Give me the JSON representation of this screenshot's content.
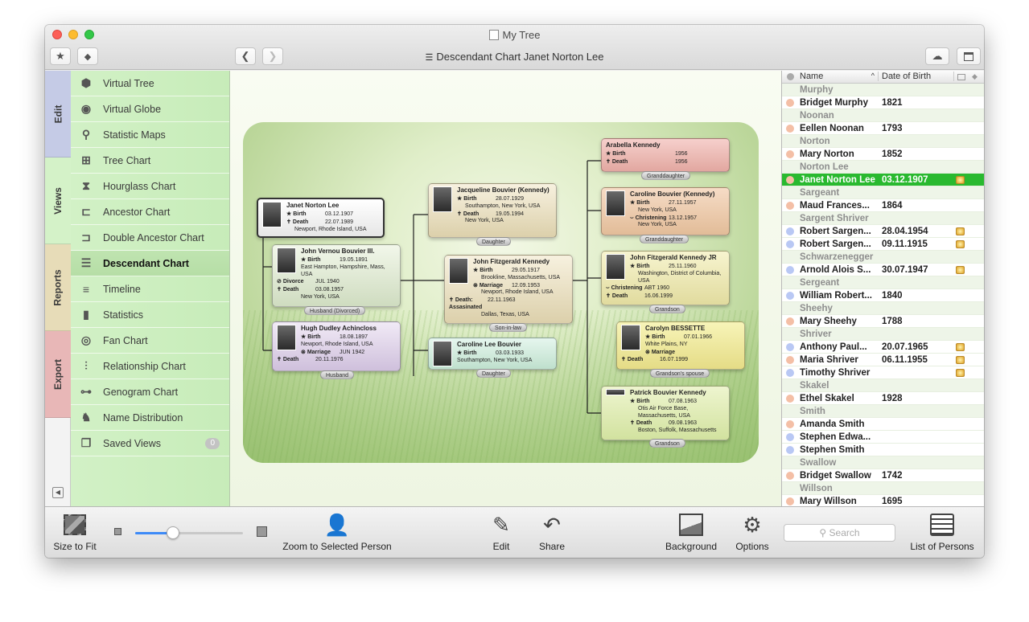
{
  "window": {
    "title": "My Tree",
    "subtitle": "Descendant Chart Janet Norton Lee"
  },
  "toolbar": {
    "favorites_icon": "star-icon",
    "tag_icon": "tag-icon",
    "back_icon": "chevron-left-icon",
    "forward_icon": "chevron-right-icon",
    "cloud_icon": "cloud-icon",
    "window_icon": "window-icon"
  },
  "tabs": [
    {
      "label": "Edit",
      "color": "#c5cbe6"
    },
    {
      "label": "Views",
      "color": "#d4f2c8"
    },
    {
      "label": "Reports",
      "color": "#e7dcb8"
    },
    {
      "label": "Export",
      "color": "#e8b7b7"
    }
  ],
  "sidebar": {
    "items": [
      {
        "label": "Virtual Tree",
        "icon": "cube-icon"
      },
      {
        "label": "Virtual Globe",
        "icon": "globe-icon"
      },
      {
        "label": "Statistic Maps",
        "icon": "map-pin-icon"
      },
      {
        "label": "Tree Chart",
        "icon": "tree-chart-icon"
      },
      {
        "label": "Hourglass Chart",
        "icon": "hourglass-chart-icon"
      },
      {
        "label": "Ancestor Chart",
        "icon": "ancestor-chart-icon"
      },
      {
        "label": "Double Ancestor Chart",
        "icon": "double-ancestor-chart-icon"
      },
      {
        "label": "Descendant Chart",
        "icon": "descendant-chart-icon",
        "selected": true
      },
      {
        "label": "Timeline",
        "icon": "timeline-icon"
      },
      {
        "label": "Statistics",
        "icon": "statistics-icon"
      },
      {
        "label": "Fan Chart",
        "icon": "fan-chart-icon"
      },
      {
        "label": "Relationship Chart",
        "icon": "relationship-chart-icon"
      },
      {
        "label": "Genogram Chart",
        "icon": "genogram-chart-icon"
      },
      {
        "label": "Name Distribution",
        "icon": "name-distribution-icon"
      },
      {
        "label": "Saved Views",
        "icon": "saved-views-icon",
        "badge": "0"
      }
    ]
  },
  "chart": {
    "root": {
      "name": "Janet Norton Lee",
      "birth_label": "Birth",
      "birth_date": "03.12.1907",
      "death_label": "Death",
      "death_date": "22.07.1989",
      "death_place": "Newport, Rhode Island, USA"
    },
    "spouse1": {
      "name": "John Vernou Bouvier III.",
      "birth_label": "Birth",
      "birth_date": "19.05.1891",
      "birth_place": "East Hampton, Hampshire, Mass, USA",
      "divorce_label": "Divorce",
      "divorce_date": "JUL 1940",
      "death_label": "Death",
      "death_date": "03.08.1957",
      "death_place": "New York, USA",
      "relation": "Husband (Divorced)"
    },
    "spouse2": {
      "name": "Hugh Dudley Achincloss",
      "birth_label": "Birth",
      "birth_date": "18.08.1897",
      "birth_place": "Newport, Rhode Island, USA",
      "marriage_label": "Marriage",
      "marriage_date": "JUN 1942",
      "death_label": "Death",
      "death_date": "20.11.1976",
      "relation": "Husband"
    },
    "jackie": {
      "name": "Jacqueline Bouvier (Kennedy)",
      "birth_label": "Birth",
      "birth_date": "28.07.1929",
      "birth_place": "Southampton, New York, USA",
      "death_label": "Death",
      "death_date": "19.05.1994",
      "death_place": "New York, USA",
      "relation": "Daughter"
    },
    "jfk": {
      "name": "John Fitzgerald Kennedy",
      "birth_label": "Birth",
      "birth_date": "29.05.1917",
      "birth_place": "Brookline, Massachusetts, USA",
      "marriage_label": "Marriage",
      "marriage_date": "12.09.1953",
      "marriage_place": "Newport, Rhode Island, USA",
      "death_label": "Death: Assasinated",
      "death_date": "22.11.1963",
      "death_place": "Dallas, Texas, USA",
      "relation": "Son-in-law"
    },
    "caroline_lee": {
      "name": "Caroline Lee Bouvier",
      "birth_label": "Birth",
      "birth_date": "03.03.1933",
      "birth_place": "Southampton, New York, USA",
      "relation": "Daughter"
    },
    "arabella": {
      "name": "Arabella Kennedy",
      "birth_label": "Birth",
      "birth_date": "1956",
      "death_label": "Death",
      "death_date": "1956",
      "relation": "Granddaughter"
    },
    "caroline_k": {
      "name": "Caroline Bouvier (Kennedy)",
      "birth_label": "Birth",
      "birth_date": "27.11.1957",
      "birth_place": "New York, USA",
      "christening_label": "Christening",
      "christening_date": "13.12.1957",
      "christening_place": "New York, USA",
      "relation": "Granddaughter"
    },
    "jfk_jr": {
      "name": "John Fitzgerald Kennedy JR",
      "birth_label": "Birth",
      "birth_date": "25.11.1960",
      "birth_place": "Washington, District of Columbia, USA",
      "christening_label": "Christening",
      "christening_date": "ABT 1960",
      "death_label": "Death",
      "death_date": "16.06.1999",
      "relation": "Grandson"
    },
    "carolyn": {
      "name": "Carolyn BESSETTE",
      "birth_label": "Birth",
      "birth_date": "07.01.1966",
      "birth_place": "White Plains, NY",
      "marriage_label": "Marriage",
      "death_label": "Death",
      "death_date": "16.07.1999",
      "relation": "Grandson's spouse"
    },
    "patrick": {
      "name": "Patrick Bouvier Kennedy",
      "birth_label": "Birth",
      "birth_date": "07.08.1963",
      "birth_place": "Otis Air Force Base, Massachusetts, USA",
      "death_label": "Death",
      "death_date": "09.08.1963",
      "death_place": "Boston, Suffolk, Massachusetts",
      "relation": "Grandson"
    }
  },
  "person_list": {
    "headers": {
      "name": "Name",
      "date_of_birth": "Date of Birth"
    },
    "rows": [
      {
        "type": "group",
        "label": "Murphy"
      },
      {
        "type": "person",
        "gender": "female",
        "name": "Bridget Murphy",
        "date": "1821"
      },
      {
        "type": "group",
        "label": "Noonan"
      },
      {
        "type": "person",
        "gender": "female",
        "name": "Eellen Noonan",
        "date": "1793"
      },
      {
        "type": "group",
        "label": "Norton"
      },
      {
        "type": "person",
        "gender": "female",
        "name": "Mary Norton",
        "date": "1852"
      },
      {
        "type": "group",
        "label": "Norton Lee"
      },
      {
        "type": "person",
        "gender": "female",
        "name": "Janet Norton Lee",
        "date": "03.12.1907",
        "media": true,
        "selected": true
      },
      {
        "type": "group",
        "label": "Sargeant"
      },
      {
        "type": "person",
        "gender": "female",
        "name": "Maud Frances...",
        "date": "1864"
      },
      {
        "type": "group",
        "label": "Sargent Shriver"
      },
      {
        "type": "person",
        "gender": "male",
        "name": "Robert Sargen...",
        "date": "28.04.1954",
        "media": true
      },
      {
        "type": "person",
        "gender": "male",
        "name": "Robert Sargen...",
        "date": "09.11.1915",
        "media": true
      },
      {
        "type": "group",
        "label": "Schwarzenegger"
      },
      {
        "type": "person",
        "gender": "male",
        "name": "Arnold Alois S...",
        "date": "30.07.1947",
        "media": true
      },
      {
        "type": "group",
        "label": "Sergeant"
      },
      {
        "type": "person",
        "gender": "male",
        "name": "William Robert...",
        "date": "1840"
      },
      {
        "type": "group",
        "label": "Sheehy"
      },
      {
        "type": "person",
        "gender": "female",
        "name": "Mary Sheehy",
        "date": "1788"
      },
      {
        "type": "group",
        "label": "Shriver"
      },
      {
        "type": "person",
        "gender": "male",
        "name": "Anthony Paul...",
        "date": "20.07.1965",
        "media": true
      },
      {
        "type": "person",
        "gender": "female",
        "name": "Maria Shriver",
        "date": "06.11.1955",
        "media": true
      },
      {
        "type": "person",
        "gender": "male",
        "name": "Timothy Shriver",
        "date": "",
        "media": true
      },
      {
        "type": "group",
        "label": "Skakel"
      },
      {
        "type": "person",
        "gender": "female",
        "name": "Ethel Skakel",
        "date": "1928"
      },
      {
        "type": "group",
        "label": "Smith"
      },
      {
        "type": "person",
        "gender": "female",
        "name": "Amanda Smith",
        "date": ""
      },
      {
        "type": "person",
        "gender": "male",
        "name": "Stephen Edwa...",
        "date": ""
      },
      {
        "type": "person",
        "gender": "male",
        "name": "Stephen Smith",
        "date": ""
      },
      {
        "type": "group",
        "label": "Swallow"
      },
      {
        "type": "person",
        "gender": "female",
        "name": "Bridget Swallow",
        "date": "1742"
      },
      {
        "type": "group",
        "label": "Willson"
      },
      {
        "type": "person",
        "gender": "female",
        "name": "Mary Willson",
        "date": "1695"
      }
    ]
  },
  "bottom_toolbar": {
    "size_to_fit": "Size to Fit",
    "zoom_to_selected": "Zoom to Selected Person",
    "edit": "Edit",
    "share": "Share",
    "background": "Background",
    "options": "Options",
    "search_placeholder": "Search",
    "list_of_persons": "List of Persons",
    "zoom_level": 0.35
  },
  "colors": {
    "male": "#b9c8f4",
    "female": "#f4bfa6",
    "selected": "#29b92f"
  }
}
